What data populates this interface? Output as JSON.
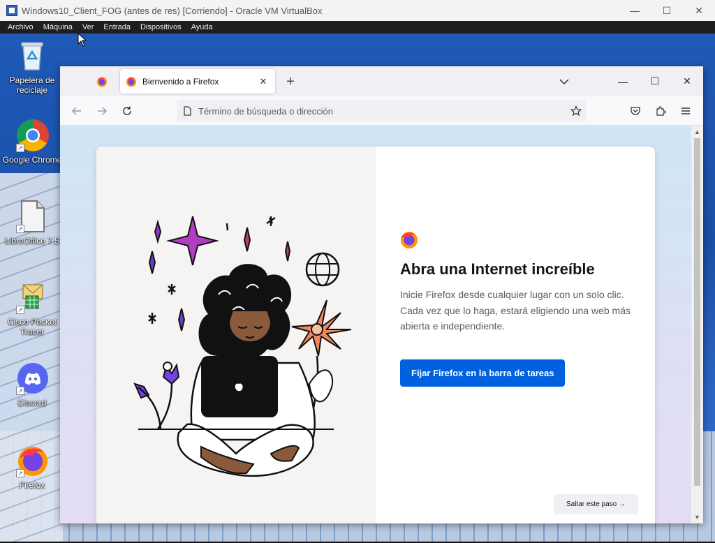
{
  "host": {
    "title": "Windows10_Client_FOG (antes de res) [Corriendo] - Oracle VM VirtualBox",
    "menu": [
      "Archivo",
      "Máquina",
      "Ver",
      "Entrada",
      "Dispositivos",
      "Ayuda"
    ],
    "controls": {
      "minimize": "—",
      "maximize": "☐",
      "close": "✕"
    }
  },
  "desktop": {
    "icons": [
      {
        "label": "Papelera de reciclaje",
        "icon": "recycle-bin-icon"
      },
      {
        "label": "Google Chrome",
        "icon": "chrome-icon"
      },
      {
        "label": "LibreOffice 7.5",
        "icon": "libreoffice-icon"
      },
      {
        "label": "Cisco Packet Tracer",
        "icon": "packet-tracer-icon"
      },
      {
        "label": "Discord",
        "icon": "discord-icon"
      },
      {
        "label": "Firefox",
        "icon": "firefox-icon"
      }
    ]
  },
  "firefox": {
    "tab": {
      "title": "Bienvenido a Firefox",
      "close": "✕"
    },
    "new_tab": "+",
    "window_controls": {
      "minimize": "—",
      "maximize": "☐",
      "close": "✕"
    },
    "urlbar": {
      "placeholder": "Término de búsqueda o dirección"
    },
    "onboarding": {
      "title": "Abra una Internet increíble",
      "subtitle": "Inicie Firefox desde cualquier lugar con un solo clic. Cada vez que lo haga, estará eligiendo una web más abierta e independiente.",
      "primary_button": "Fijar Firefox en la barra de tareas",
      "skip_button": "Saltar este paso →"
    }
  },
  "colors": {
    "accent": "#0061e0",
    "tabbar": "#f0f0f4",
    "desktop": "#1f5ab8"
  }
}
